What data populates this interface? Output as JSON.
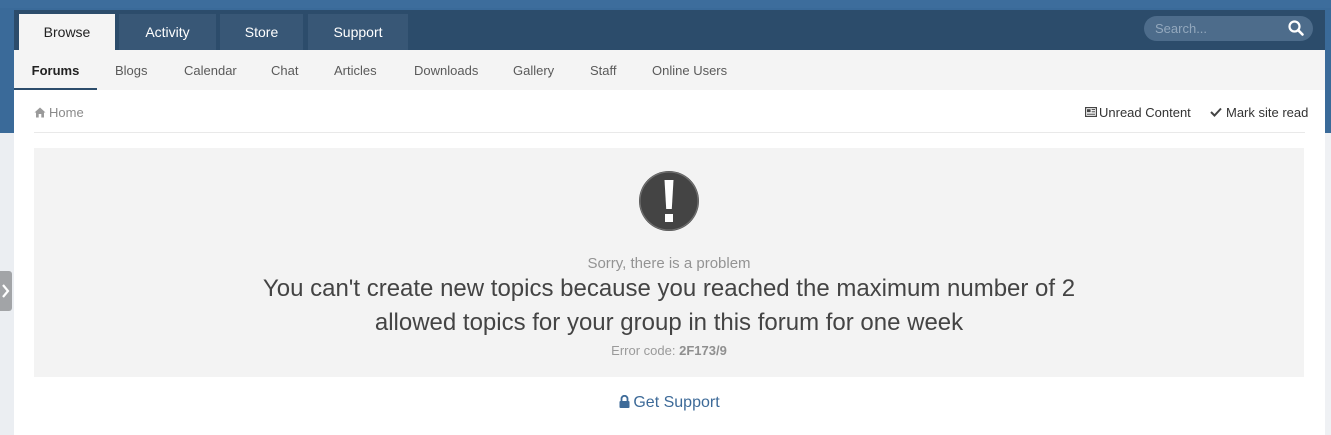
{
  "nav_primary": {
    "tabs": [
      {
        "label": "Browse",
        "active": true
      },
      {
        "label": "Activity",
        "active": false
      },
      {
        "label": "Store",
        "active": false
      },
      {
        "label": "Support",
        "active": false
      }
    ]
  },
  "search": {
    "placeholder": "Search..."
  },
  "nav_secondary": {
    "items": [
      {
        "label": "Forums",
        "active": true
      },
      {
        "label": "Blogs"
      },
      {
        "label": "Calendar"
      },
      {
        "label": "Chat"
      },
      {
        "label": "Articles"
      },
      {
        "label": "Downloads"
      },
      {
        "label": "Gallery"
      },
      {
        "label": "Staff"
      },
      {
        "label": "Online Users"
      }
    ]
  },
  "breadcrumb": {
    "home_label": "Home"
  },
  "quick_links": {
    "unread_label": "Unread Content",
    "mark_read_label": "Mark site read"
  },
  "error": {
    "subtitle": "Sorry, there is a problem",
    "message": "You can't create new topics because you reached the maximum number of 2 allowed topics for your group in this forum for one week",
    "code_label": "Error code:",
    "code_value": "2F173/9"
  },
  "support": {
    "link_label": "Get Support"
  },
  "icons": {
    "search": "search-icon",
    "home": "home-icon",
    "unread": "newspaper-icon",
    "check": "check-icon",
    "error": "exclamation-circle-icon",
    "lock": "lock-icon",
    "side": "chevron-right-icon"
  },
  "colors": {
    "header_bg": "#2c4c6b",
    "tab_bg": "#385776",
    "band_bg": "#3a6a99",
    "link": "#3d6a98",
    "error_icon": "#444444"
  }
}
